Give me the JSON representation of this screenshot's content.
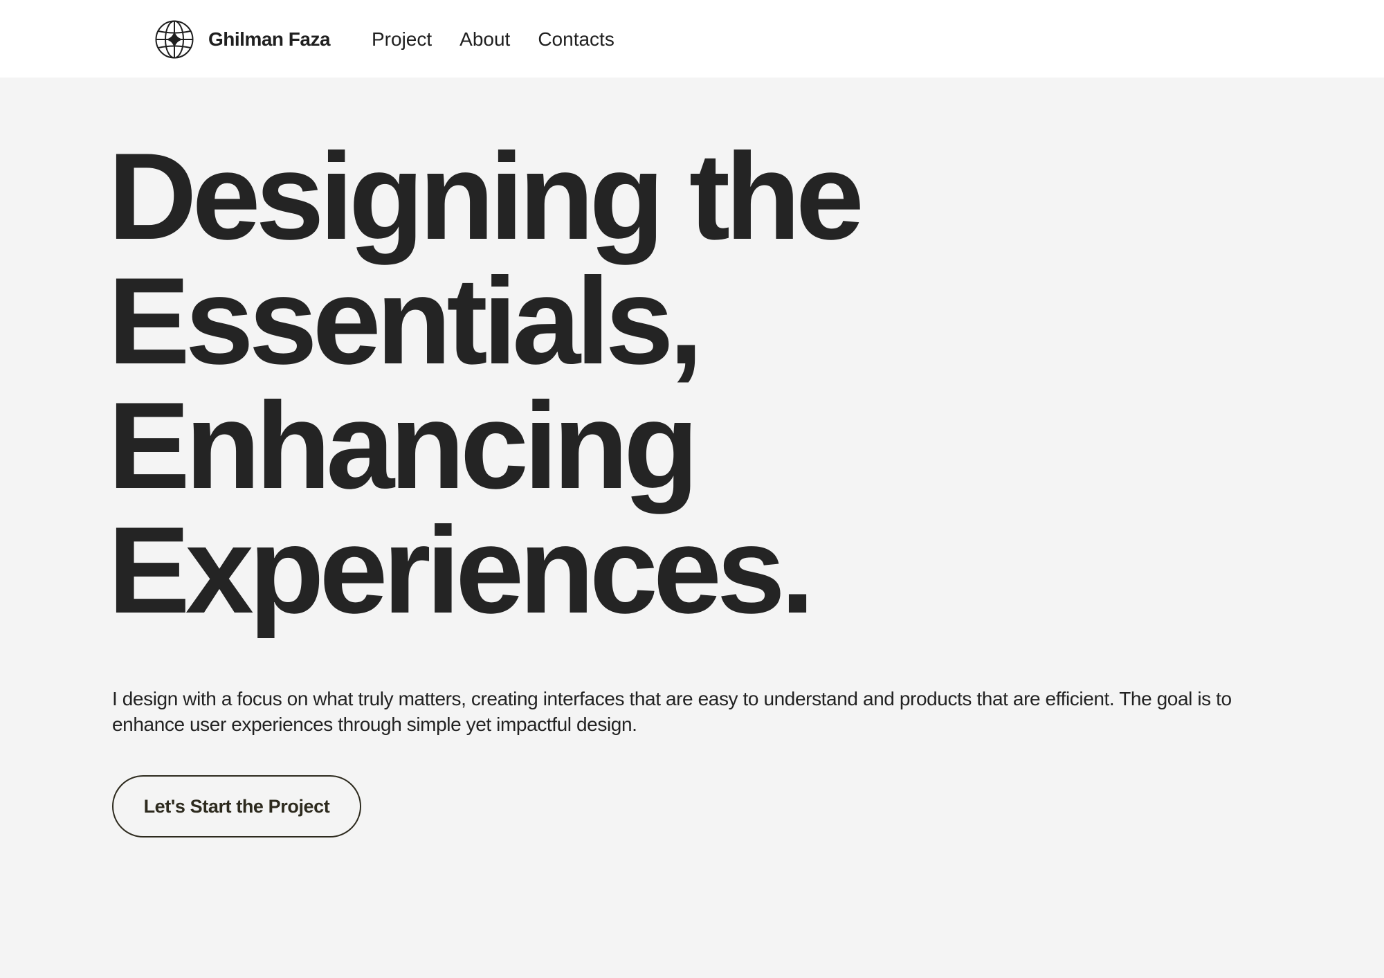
{
  "header": {
    "logo_icon": "globe-sparkle-icon",
    "brand": "Ghilman Faza",
    "nav": [
      {
        "label": "Project"
      },
      {
        "label": "About"
      },
      {
        "label": "Contacts"
      }
    ]
  },
  "hero": {
    "title_lines": [
      "Designing the",
      "Essentials,",
      "Enhancing",
      "Experiences."
    ],
    "description": "I design with a focus on what truly matters, creating interfaces that are easy to understand and products that are efficient. The goal is to enhance user experiences through simple yet impactful design.",
    "cta_label": "Let's Start the Project"
  },
  "colors": {
    "page_background": "#f4f4f4",
    "header_background": "#ffffff",
    "text": "#222222",
    "button_outline": "#2d2a1e"
  }
}
